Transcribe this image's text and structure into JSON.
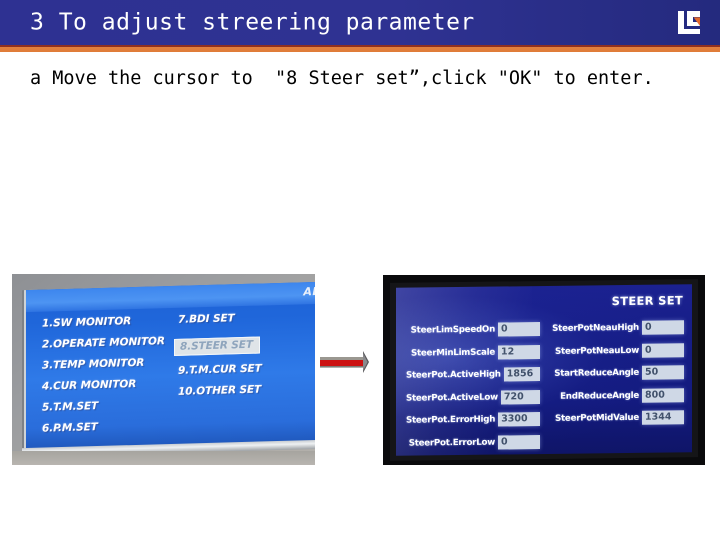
{
  "header": {
    "title": "3 To adjust streering parameter",
    "logo_icon": "lg-brand-logo-icon",
    "bar_color": "#2e3192",
    "accent_color": "#e07c38"
  },
  "body": {
    "instruction": "a Move the cursor to  \"8 Steer set”,click \"OK\" to enter."
  },
  "figures": {
    "left_photo": {
      "caption_overlay": "AD",
      "menu_column_1": [
        "1.SW MONITOR",
        "2.OPERATE MONITOR",
        "3.TEMP MONITOR",
        "4.CUR MONITOR",
        "5.T.M.SET",
        "6.P.M.SET"
      ],
      "menu_column_2": [
        "7.BDI SET",
        "8.STEER SET",
        "9.T.M.CUR SET",
        "10.OTHER SET"
      ],
      "selected_item": "8.STEER SET",
      "screen_color": "#2a6ddb"
    },
    "arrow": {
      "icon": "right-arrow-icon",
      "color": "#cc1111",
      "direction": "right"
    },
    "right_photo": {
      "screen_title": "STEER SET",
      "screen_color": "#161d86",
      "fields_column_1": [
        {
          "label": "SteerLimSpeedOn",
          "value": "0"
        },
        {
          "label": "SteerMinLimScale",
          "value": "12"
        },
        {
          "label": "SteerPot.ActiveHigh",
          "value": "1856"
        },
        {
          "label": "SteerPot.ActiveLow",
          "value": "720"
        },
        {
          "label": "SteerPot.ErrorHigh",
          "value": "3300"
        },
        {
          "label": "SteerPot.ErrorLow",
          "value": "0"
        }
      ],
      "fields_column_2": [
        {
          "label": "SteerPotNeauHigh",
          "value": "0"
        },
        {
          "label": "SteerPotNeauLow",
          "value": "0"
        },
        {
          "label": "StartReduceAngle",
          "value": "50"
        },
        {
          "label": "EndReduceAngle",
          "value": "800"
        },
        {
          "label": "SteerPotMidValue",
          "value": "1344"
        }
      ]
    }
  }
}
